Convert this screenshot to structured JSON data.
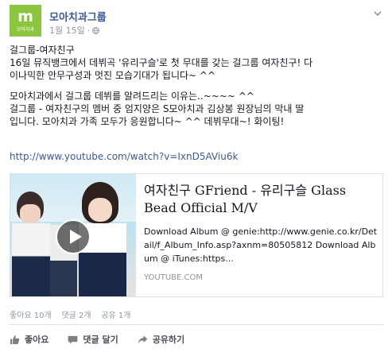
{
  "post": {
    "page_name": "모아치과그룹",
    "avatar_text": "모아치과",
    "timestamp": "1월 15일",
    "body": {
      "line1": "걸그룹-여자친구",
      "line2": "16일 뮤직뱅크에서 데뷔곡 '유리구슬'로 첫 무대를 갖는 걸그룹 여자친구! 다",
      "line3": "이나믹한 안무구성과 멋진 모습기대가 됩니다~ ^^",
      "line4": "모아치과에서 걸그룹 데뷔를 알려드리는 이유는..~~~~ ^^",
      "line5": "걸그룹 - 여자친구의 멤버 중 엄지양은 S모아치과 김상봉 원장님의 막내 딸",
      "line6": "입니다. 모아치과 가족 모두가 응원합니다~ ^^ 데뷔무대~! 화이팅!"
    },
    "link": "http://www.youtube.com/watch?v=IxnD5AViu6k"
  },
  "shared_link": {
    "title": "여자친구 GFriend - 유리구슬 Glass Bead Official M/V",
    "description": "Download Album @ genie:http://www.genie.co.kr/Detail/f_Album_Info.asp?axnm=80505812 Download Album @ iTunes:https...",
    "domain": "YOUTUBE.COM"
  },
  "stats": {
    "likes": "좋아요 10개",
    "comments": "댓글 2개",
    "shares": "공유 1개"
  },
  "actions": {
    "like": "좋아요",
    "comment": "댓글 달기",
    "share": "공유하기"
  },
  "icons": {
    "avatar": "moachi-logo",
    "privacy": "globe-icon",
    "menu": "chevron-down-icon",
    "video": "play-icon",
    "like": "thumbs-up-icon",
    "comment": "comment-icon",
    "share": "share-arrow-icon"
  },
  "colors": {
    "brand_green": "#8cc63e",
    "link_blue": "#3b5998",
    "meta_gray": "#9197a3"
  }
}
